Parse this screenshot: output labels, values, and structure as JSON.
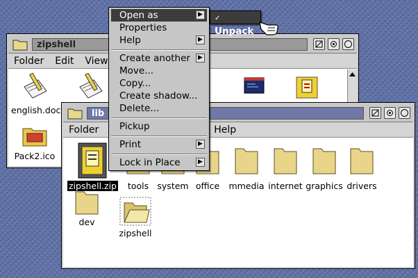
{
  "zipshell_window": {
    "title": "zipshell",
    "menu": [
      "Folder",
      "Edit",
      "View"
    ],
    "icons": [
      {
        "label": "english.doc",
        "icon": "document-pen-icon"
      },
      {
        "label": "",
        "icon": "document-pen-icon"
      },
      {
        "label": "Pack2.ico",
        "icon": "folder-icon"
      },
      {
        "label": "",
        "icon": "program-window-icon"
      },
      {
        "label": "",
        "icon": "zip-archive-icon"
      }
    ]
  },
  "lib_window": {
    "title": "lib",
    "menu": [
      "Folder",
      "Help"
    ],
    "icons": [
      {
        "label": "zipshell.zip",
        "icon": "zip-archive-icon",
        "selected": true
      },
      {
        "label": "tools",
        "icon": "folder-icon"
      },
      {
        "label": "system",
        "icon": "folder-icon"
      },
      {
        "label": "office",
        "icon": "folder-icon"
      },
      {
        "label": "mmedia",
        "icon": "folder-icon"
      },
      {
        "label": "internet",
        "icon": "folder-icon"
      },
      {
        "label": "graphics",
        "icon": "folder-icon"
      },
      {
        "label": "drivers",
        "icon": "folder-icon"
      },
      {
        "label": "dev",
        "icon": "folder-icon"
      },
      {
        "label": "zipshell",
        "icon": "open-folder-icon"
      }
    ]
  },
  "context_menu": {
    "items": [
      {
        "label": "Open as",
        "submenu": true,
        "highlighted": true
      },
      {
        "label": "Properties"
      },
      {
        "label": "Help",
        "submenu": true
      },
      {
        "label": "Create another",
        "submenu": true
      },
      {
        "label": "Move..."
      },
      {
        "label": "Copy..."
      },
      {
        "label": "Create shadow..."
      },
      {
        "label": "Delete..."
      },
      {
        "label": "Pickup"
      },
      {
        "label": "Print",
        "submenu": true
      },
      {
        "label": "Lock in Place",
        "submenu": true
      }
    ],
    "submenu_item": "Unpack"
  },
  "colors": {
    "desktop": "#5d6fa6",
    "menu_highlight": "#3c3c3c",
    "active_title": "#6f78a8"
  }
}
